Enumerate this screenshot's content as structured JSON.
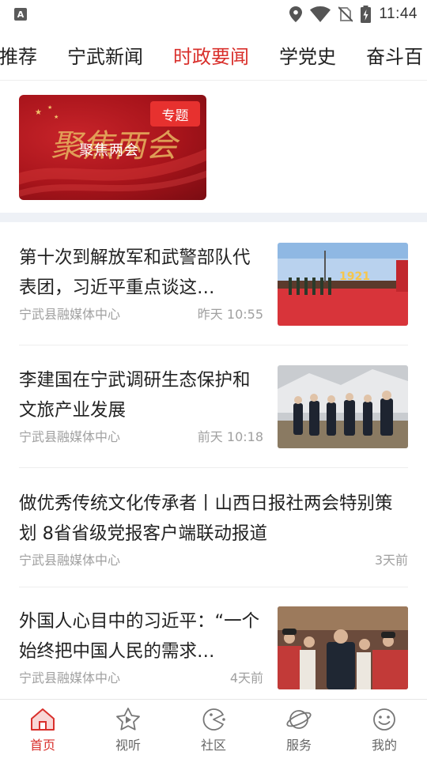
{
  "status_bar": {
    "keyboard_indicator": "A",
    "time": "11:44",
    "icons": [
      "location-icon",
      "wifi-icon",
      "no-sim-icon",
      "battery-charging-icon"
    ]
  },
  "tabs": [
    {
      "label": "推荐"
    },
    {
      "label": "宁武新闻"
    },
    {
      "label": "时政要闻",
      "active": true
    },
    {
      "label": "学党史"
    },
    {
      "label": "奋斗百"
    }
  ],
  "banner": {
    "title": "聚焦两会",
    "tag": "专题",
    "calligraphy": "聚焦两会"
  },
  "news": [
    {
      "title": "第十次到解放军和武警部队代表团，习近平重点谈这…",
      "source": "宁武县融媒体中心",
      "time": "昨天 10:55",
      "thumb_text": "1921"
    },
    {
      "title": "李建国在宁武调研生态保护和文旅产业发展",
      "source": "宁武县融媒体中心",
      "time": "前天 10:18",
      "thumb_text": ""
    },
    {
      "title": "做优秀传统文化传承者丨山西日报社两会特别策划 8省省级党报客户端联动报道",
      "source": "宁武县融媒体中心",
      "time": "3天前"
    },
    {
      "title": "外国人心目中的习近平：“一个始终把中国人民的需求…",
      "source": "宁武县融媒体中心",
      "time": "4天前"
    }
  ],
  "bottom_nav": [
    {
      "label": "首页",
      "icon": "home-icon",
      "active": true
    },
    {
      "label": "视听",
      "icon": "play-star-icon"
    },
    {
      "label": "社区",
      "icon": "community-icon"
    },
    {
      "label": "服务",
      "icon": "planet-icon"
    },
    {
      "label": "我的",
      "icon": "smiley-icon"
    }
  ],
  "colors": {
    "accent": "#d9302c",
    "banner_red": "#a8141b",
    "divider": "#eef1f6"
  }
}
